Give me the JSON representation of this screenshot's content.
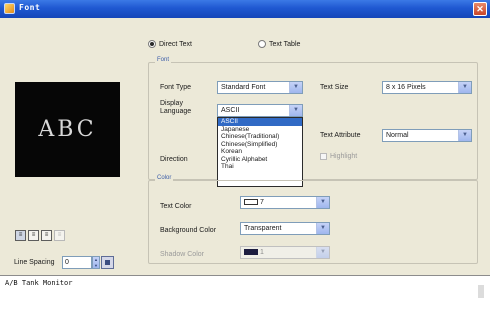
{
  "window": {
    "title": "Font"
  },
  "source_options": [
    {
      "label": "Direct Text",
      "selected": true
    },
    {
      "label": "Text Table",
      "selected": false
    }
  ],
  "font_group": {
    "legend": "Font",
    "font_type_label": "Font Type",
    "font_type_value": "Standard Font",
    "text_size_label": "Text Size",
    "text_size_value": "8 x 16 Pixels",
    "display_language_label": "Display Language",
    "display_language_value": "ASCII",
    "language_options": [
      "ASCII",
      "Japanese",
      "Chinese(Traditional)",
      "Chinese(Simplified)",
      "Korean",
      "Cyrillic Alphabet",
      "Thai"
    ],
    "text_attribute_label": "Text Attribute",
    "text_attribute_value": "Normal",
    "direction_label": "Direction",
    "highlight_label": "Highlight"
  },
  "color_group": {
    "legend": "Color",
    "text_color_label": "Text Color",
    "text_color_value": "7",
    "background_color_label": "Background Color",
    "background_color_value": "Transparent",
    "shadow_color_label": "Shadow Color",
    "shadow_color_value": "1"
  },
  "preview": {
    "text": "ABC"
  },
  "line_spacing": {
    "label": "Line Spacing",
    "value": "0"
  },
  "bottom_text": "A/B Tank Monitor",
  "colors": {
    "titlebar": "#1f58d1",
    "preview_bg": "#060606",
    "selection": "#316ac5"
  }
}
